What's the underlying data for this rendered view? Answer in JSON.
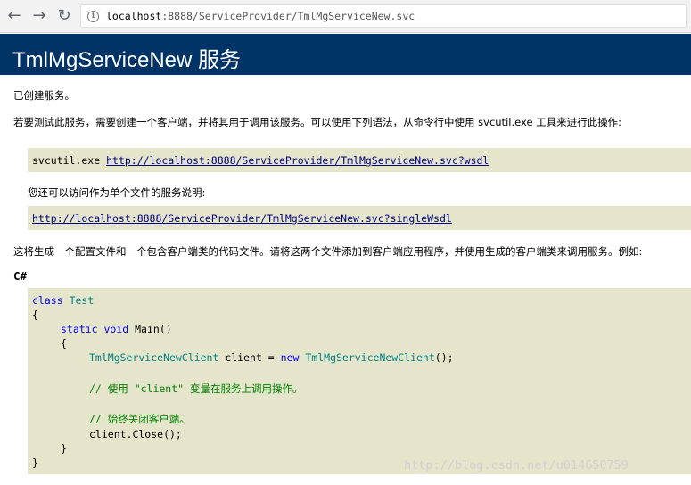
{
  "browser": {
    "back_icon": "arrow-left-icon",
    "forward_icon": "arrow-right-icon",
    "reload_icon": "reload-icon",
    "info_icon": "info-icon",
    "url_host": "localhost",
    "url_rest": ":8888/ServiceProvider/TmlMgServiceNew.svc"
  },
  "page": {
    "title": "TmlMgServiceNew 服务",
    "created": "已创建服务。",
    "intro": "若要测试此服务，需要创建一个客户端，并将其用于调用该服务。可以使用下列语法，从命令行中使用 svcutil.exe 工具来进行此操作:",
    "svcutil_cmd": "svcutil.exe ",
    "wsdl_link": "http://localhost:8888/ServiceProvider/TmlMgServiceNew.svc?wsdl",
    "single_file_text": "您还可以访问作为单个文件的服务说明:",
    "single_wsdl_link": "http://localhost:8888/ServiceProvider/TmlMgServiceNew.svc?singleWsdl",
    "generate_text": "这将生成一个配置文件和一个包含客户端类的代码文件。请将这两个文件添加到客户端应用程序，并使用生成的客户端类来调用服务。例如:",
    "lang_heading": "C#"
  },
  "code": {
    "l1_kw": "class",
    "l1_ty": "Test",
    "l2": "{",
    "l3_kw1": "static",
    "l3_kw2": "void",
    "l3_rest": "Main()",
    "l4": "{",
    "l5_ty1": "TmlMgServiceNewClient",
    "l5_mid": " client = ",
    "l5_kw": "new",
    "l5_ty2": "TmlMgServiceNewClient",
    "l5_end": "();",
    "l6": "// 使用 \"client\" 变量在服务上调用操作。",
    "l7": "// 始终关闭客户端。",
    "l8": "client.Close();",
    "l9": "}",
    "l10": "}"
  },
  "watermark": "http://blog.csdn.net/u014650759",
  "colors": {
    "header_bg": "#003366",
    "code_bg": "#e5e5cc",
    "keyword": "#0000ff",
    "type": "#008080",
    "comment": "#008000",
    "link": "#000080"
  }
}
